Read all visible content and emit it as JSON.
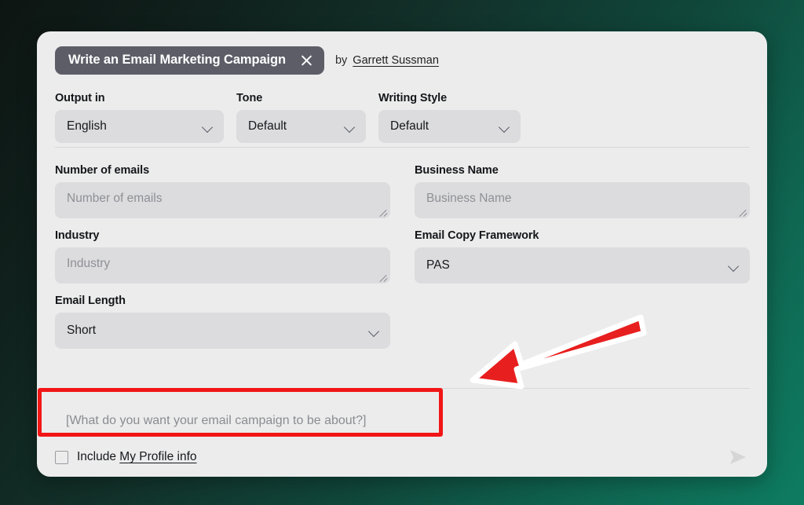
{
  "app": {
    "background_gradient_from": "#0d1512",
    "background_gradient_to": "#0e7c61",
    "card_background": "#ececec"
  },
  "header": {
    "title": "Write an Email Marketing Campaign",
    "close_icon": "close-icon",
    "by_label": "by",
    "author": "Garrett Sussman",
    "chip_color": "#5d5d68"
  },
  "selectors": [
    {
      "label": "Output in",
      "value": "English",
      "icon": "chevron-down-icon",
      "name": "output-language"
    },
    {
      "label": "Tone",
      "value": "Default",
      "icon": "chevron-down-icon",
      "name": "tone"
    },
    {
      "label": "Writing Style",
      "value": "Default",
      "icon": "chevron-down-icon",
      "name": "writing-style"
    }
  ],
  "fields": {
    "number_of_emails": {
      "label": "Number of emails",
      "placeholder": "Number of emails",
      "value": "",
      "type": "textarea"
    },
    "business_name": {
      "label": "Business Name",
      "placeholder": "Business Name",
      "value": "",
      "type": "textarea"
    },
    "industry": {
      "label": "Industry",
      "placeholder": "Industry",
      "value": "",
      "type": "textarea"
    },
    "email_copy_framework": {
      "label": "Email Copy Framework",
      "value": "PAS",
      "icon": "chevron-down-icon",
      "type": "select"
    },
    "email_length": {
      "label": "Email Length",
      "value": "Short",
      "icon": "chevron-down-icon",
      "type": "select"
    }
  },
  "prompt": {
    "placeholder": "[What do you want your email campaign to be about?]",
    "value": ""
  },
  "footer": {
    "include_label": "Include",
    "profile_link": "My Profile info",
    "checkbox_checked": false,
    "send_icon": "send-arrow-icon"
  },
  "annotations": {
    "highlight_box_color": "#f21616",
    "arrow_color": "#e81f1f",
    "arrow_outline_color": "#ffffff",
    "arrow_direction": "left"
  }
}
